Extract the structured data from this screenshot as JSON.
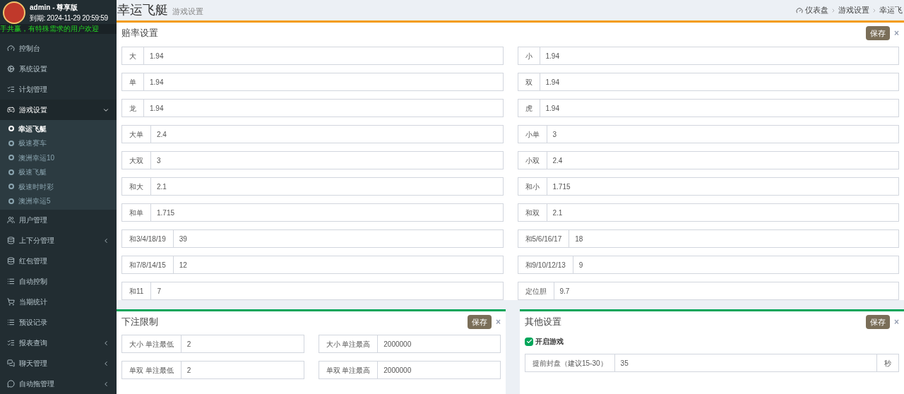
{
  "user": {
    "name": "admin - 尊享版",
    "expiry": "到期: 2024-11-29 20:59:59"
  },
  "marquee": "手共赢，有特殊需求的用户欢迎",
  "sidebar": {
    "items": [
      {
        "label": "控制台",
        "kind": "link",
        "expanded": false
      },
      {
        "label": "系统设置",
        "kind": "link",
        "expanded": false
      },
      {
        "label": "计划管理",
        "kind": "link",
        "expanded": false
      },
      {
        "label": "游戏设置",
        "kind": "menu",
        "expanded": true,
        "children": [
          {
            "label": "幸运飞艇",
            "selected": true
          },
          {
            "label": "极速赛车",
            "selected": false
          },
          {
            "label": "澳洲幸运10",
            "selected": false
          },
          {
            "label": "极速飞艇",
            "selected": false
          },
          {
            "label": "极速时时彩",
            "selected": false
          },
          {
            "label": "澳洲幸运5",
            "selected": false
          }
        ]
      },
      {
        "label": "用户管理",
        "kind": "link",
        "expanded": false
      },
      {
        "label": "上下分管理",
        "kind": "menu",
        "expanded": false
      },
      {
        "label": "红包管理",
        "kind": "link",
        "expanded": false
      },
      {
        "label": "自动控制",
        "kind": "link",
        "expanded": false
      },
      {
        "label": "当期统计",
        "kind": "link",
        "expanded": false
      },
      {
        "label": "预设记录",
        "kind": "link",
        "expanded": false
      },
      {
        "label": "报表查询",
        "kind": "menu",
        "expanded": false
      },
      {
        "label": "聊天管理",
        "kind": "menu",
        "expanded": false
      },
      {
        "label": "自动拖管理",
        "kind": "menu",
        "expanded": false
      }
    ]
  },
  "page": {
    "title": "幸运飞艇",
    "subtitle": "游戏设置",
    "breadcrumb": [
      "仪表盘",
      "游戏设置",
      "幸运飞"
    ]
  },
  "odds_box": {
    "title": "赔率设置",
    "save": "保存",
    "close": "×",
    "fields": [
      {
        "label": "大",
        "value": "1.94"
      },
      {
        "label": "小",
        "value": "1.94"
      },
      {
        "label": "单",
        "value": "1.94"
      },
      {
        "label": "双",
        "value": "1.94"
      },
      {
        "label": "龙",
        "value": "1.94"
      },
      {
        "label": "虎",
        "value": "1.94"
      },
      {
        "label": "大单",
        "value": "2.4"
      },
      {
        "label": "小单",
        "value": "3"
      },
      {
        "label": "大双",
        "value": "3"
      },
      {
        "label": "小双",
        "value": "2.4"
      },
      {
        "label": "和大",
        "value": "2.1"
      },
      {
        "label": "和小",
        "value": "1.715"
      },
      {
        "label": "和单",
        "value": "1.715"
      },
      {
        "label": "和双",
        "value": "2.1"
      },
      {
        "label": "和3/4/18/19",
        "value": "39"
      },
      {
        "label": "和5/6/16/17",
        "value": "18"
      },
      {
        "label": "和7/8/14/15",
        "value": "12"
      },
      {
        "label": "和9/10/12/13",
        "value": "9"
      },
      {
        "label": "和11",
        "value": "7"
      },
      {
        "label": "定位胆",
        "value": "9.7"
      }
    ]
  },
  "limit_box": {
    "title": "下注限制",
    "save": "保存",
    "close": "×",
    "fields": [
      {
        "label": "大小 单注最低",
        "value": "2"
      },
      {
        "label": "大小 单注最高",
        "value": "2000000"
      },
      {
        "label": "单双 单注最低",
        "value": "2"
      },
      {
        "label": "单双 单注最高",
        "value": "2000000"
      }
    ]
  },
  "other_box": {
    "title": "其他设置",
    "save": "保存",
    "close": "×",
    "enable": {
      "label": "开启游戏",
      "checked": true
    },
    "close_field": {
      "label": "提前封盘（建议15-30）",
      "value": "35",
      "unit": "秒"
    }
  }
}
